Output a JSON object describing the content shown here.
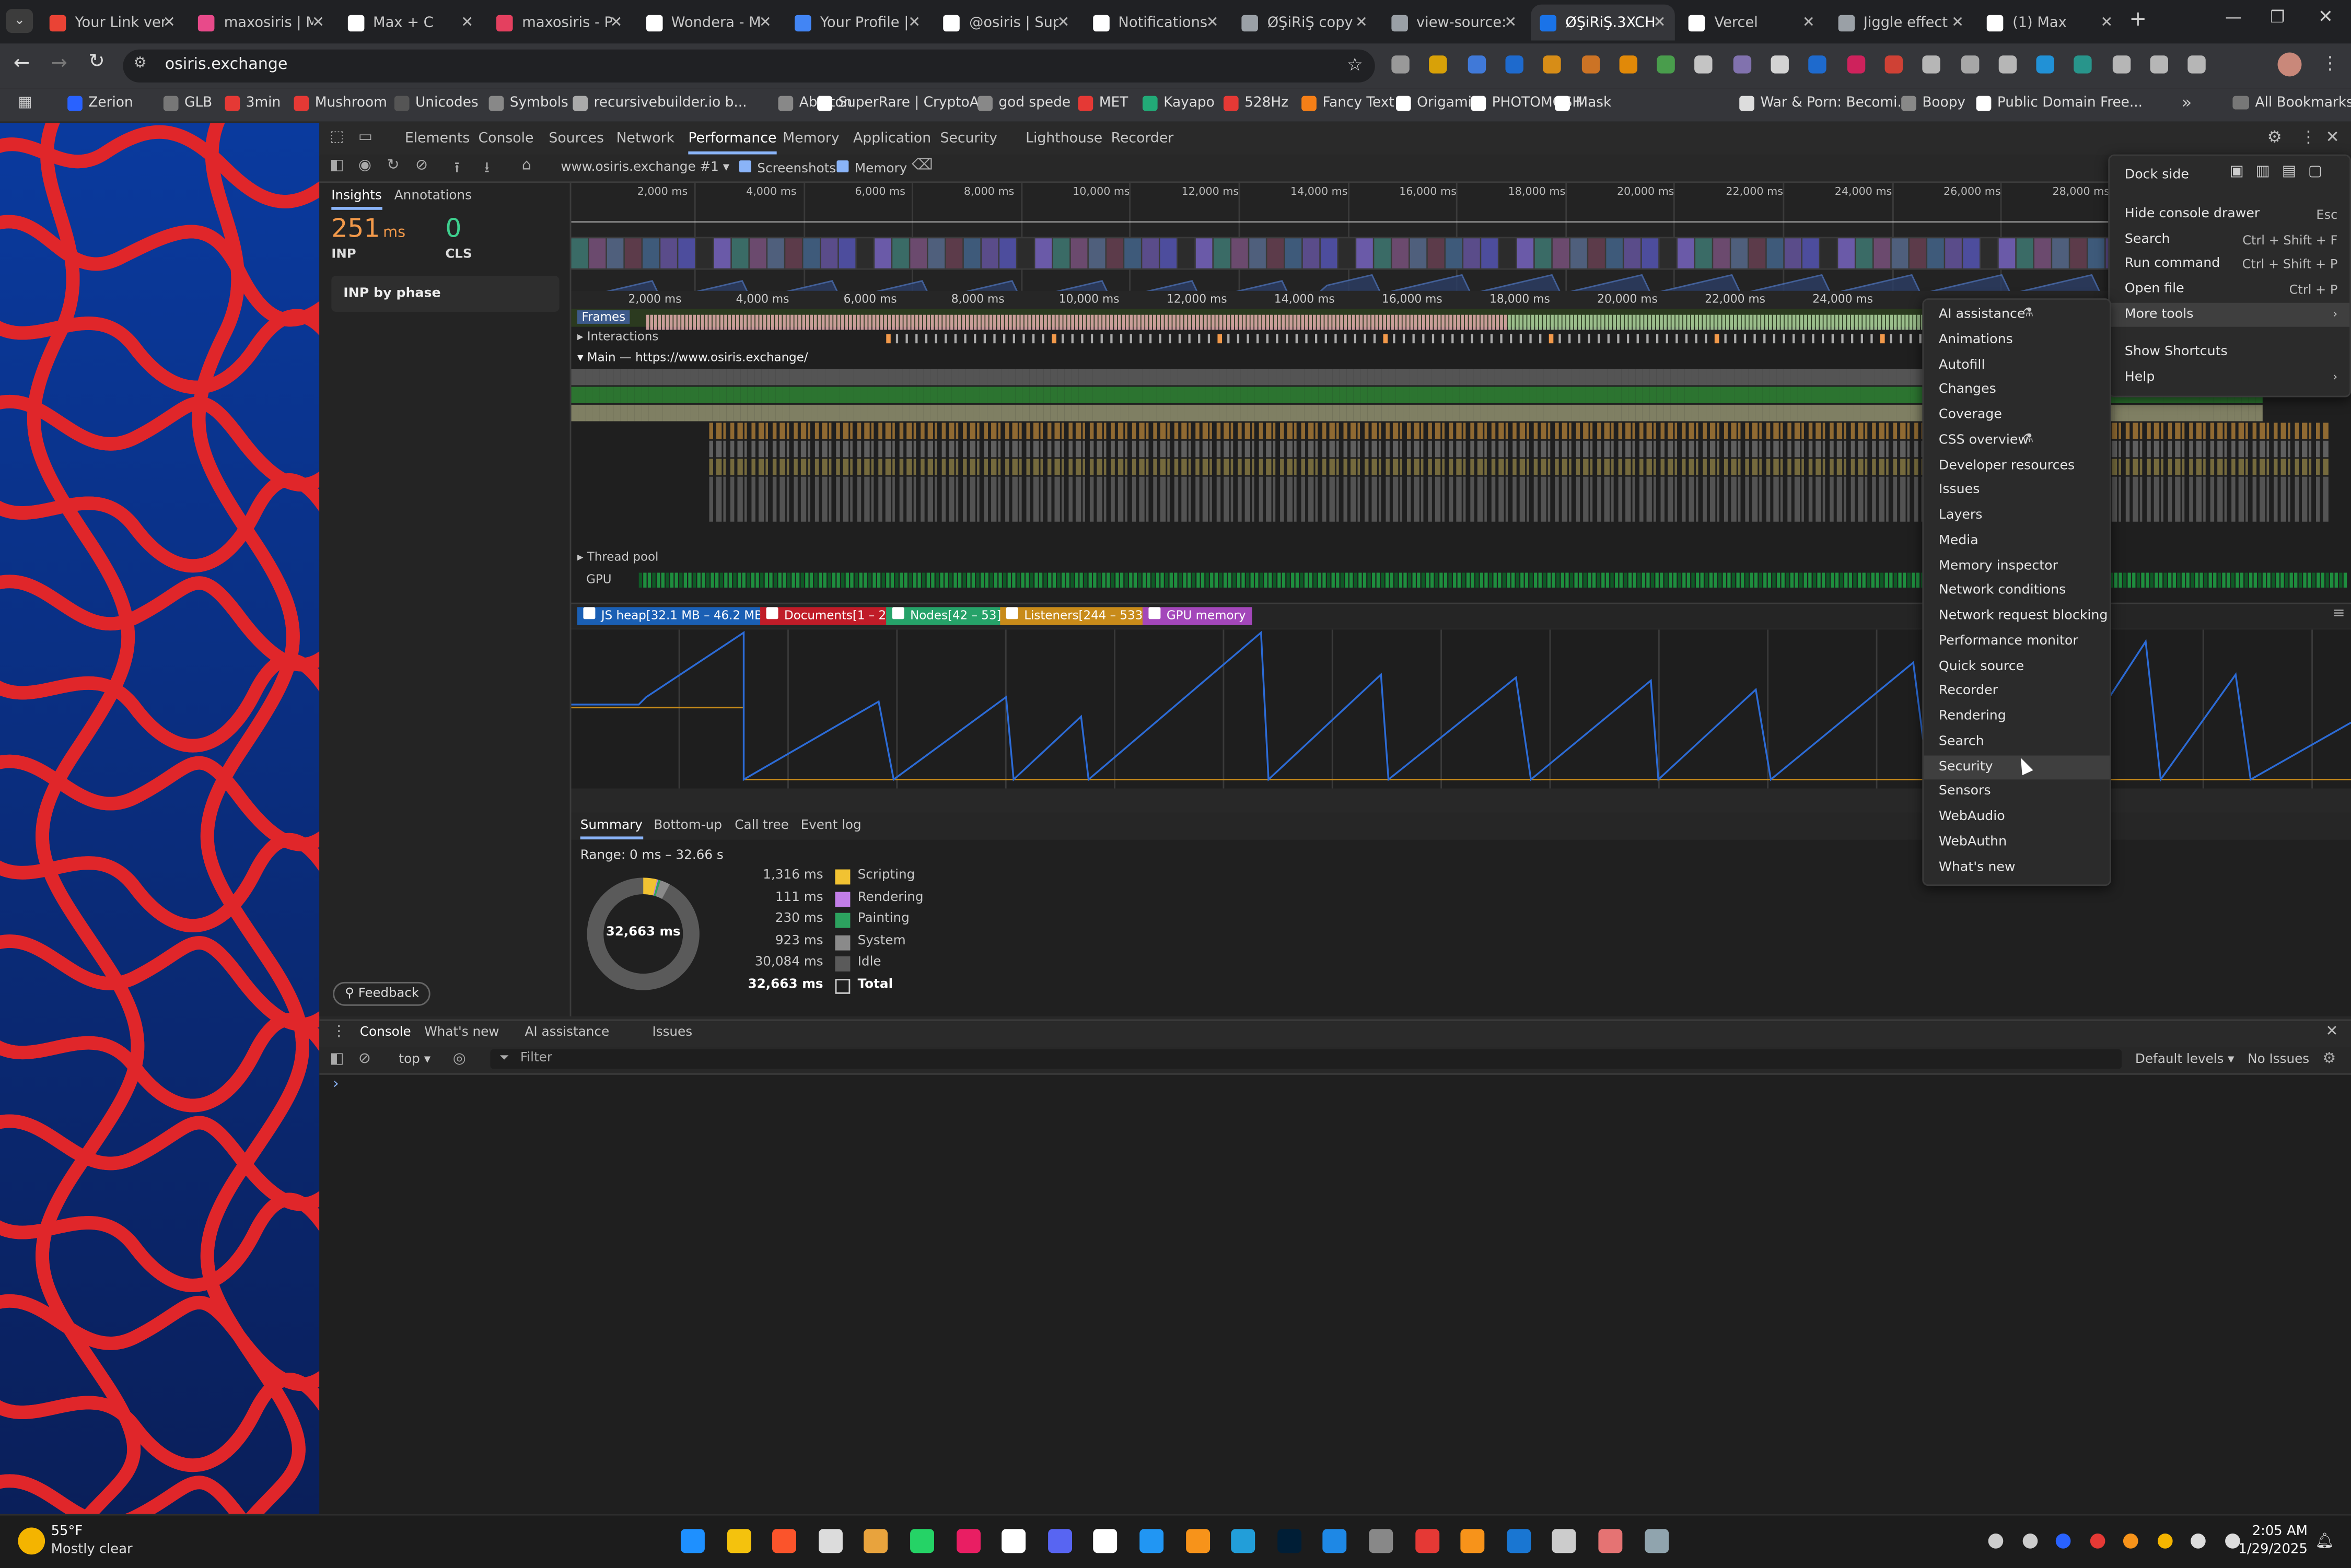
{
  "browser": {
    "tabs": [
      {
        "label": "Your Link ver",
        "color": "#ea4335"
      },
      {
        "label": "maxosiris | M",
        "color": "#e84a8a"
      },
      {
        "label": "Max + C",
        "color": "#ffffff"
      },
      {
        "label": "maxosiris - P",
        "color": "#e4405f"
      },
      {
        "label": "Wondera - M",
        "color": "#ffffff"
      },
      {
        "label": "Your Profile |",
        "color": "#4285f4"
      },
      {
        "label": "@osiris | Sup",
        "color": "#ffffff"
      },
      {
        "label": "Notifications",
        "color": "#ffffff"
      },
      {
        "label": "ØŞiRiŞ copy",
        "color": "#9aa0a6"
      },
      {
        "label": "view-source:",
        "color": "#9aa0a6"
      },
      {
        "label": "ØŞiRiŞ.3XCH",
        "color": "#1a73e8"
      },
      {
        "label": "Vercel",
        "color": "#ffffff"
      },
      {
        "label": "Jiggle effect",
        "color": "#9aa0a6"
      },
      {
        "label": "(1) Max",
        "color": "#ffffff"
      }
    ],
    "active_tab_index": 10,
    "url": "osiris.exchange",
    "bookmarks": [
      "Zerion",
      "GLB",
      "3min",
      "Mushroom",
      "Unicodes",
      "Symbols",
      "recursivebuilder.io b...",
      "Ableton",
      "SuperRare | CryptoA...",
      "god spede",
      "MET",
      "Kayapo",
      "528Hz",
      "Fancy Text",
      "Origami",
      "PHOTOMOSH",
      "Mask",
      "War & Porn: Becomi...",
      "Boopy",
      "Public Domain Free..."
    ],
    "all_bookmarks": "All Bookmarks"
  },
  "devtools": {
    "tabs": [
      "Elements",
      "Console",
      "Sources",
      "Network",
      "Performance",
      "Memory",
      "Application",
      "Security",
      "Lighthouse",
      "Recorder"
    ],
    "active_tab": "Performance",
    "recording_select": "www.osiris.exchange #1",
    "screenshots_label": "Screenshots",
    "memory_label": "Memory",
    "sidebar": {
      "tabs": [
        "Insights",
        "Annotations"
      ],
      "inp_value": "251",
      "inp_unit": "ms",
      "inp_label": "INP",
      "cls_value": "0",
      "cls_label": "CLS",
      "inp_by_phase": "INP by phase",
      "feedback": "Feedback"
    },
    "ruler_top": [
      "2,000 ms",
      "4,000 ms",
      "6,000 ms",
      "8,000 ms",
      "10,000 ms",
      "12,000 ms",
      "14,000 ms",
      "16,000 ms",
      "18,000 ms",
      "20,000 ms",
      "22,000 ms",
      "24,000 ms",
      "26,000 ms",
      "28,000 ms"
    ],
    "ruler_main": [
      "2,000 ms",
      "4,000 ms",
      "6,000 ms",
      "8,000 ms",
      "10,000 ms",
      "12,000 ms",
      "14,000 ms",
      "16,000 ms",
      "18,000 ms",
      "20,000 ms",
      "22,000 ms",
      "24,000 ms"
    ],
    "tracks": {
      "frames": "Frames",
      "interactions": "Interactions",
      "main": "Main — https://www.osiris.exchange/",
      "thread_pool": "Thread pool",
      "gpu": "GPU"
    },
    "memory_counters": [
      {
        "label": "JS heap[32.1 MB – 46.2 MB]",
        "color": "#1a5fb4"
      },
      {
        "label": "Documents[1 – 2]",
        "color": "#c01c28"
      },
      {
        "label": "Nodes[42 – 53]",
        "color": "#26a269"
      },
      {
        "label": "Listeners[244 – 533]",
        "color": "#c88b1a"
      },
      {
        "label": "GPU memory",
        "color": "#a347ba"
      }
    ],
    "bottom_tabs": [
      "Summary",
      "Bottom-up",
      "Call tree",
      "Event log"
    ],
    "range": "Range: 0 ms – 32.66 s",
    "donut_total": "32,663 ms",
    "summary": [
      {
        "value": "1,316 ms",
        "label": "Scripting",
        "color": "#f1c232",
        "fraction": 0.04
      },
      {
        "value": "111 ms",
        "label": "Rendering",
        "color": "#c27ee8",
        "fraction": 0.003
      },
      {
        "value": "230 ms",
        "label": "Painting",
        "color": "#2ca25f",
        "fraction": 0.007
      },
      {
        "value": "923 ms",
        "label": "System",
        "color": "#8a8a8a",
        "fraction": 0.028
      },
      {
        "value": "30,084 ms",
        "label": "Idle",
        "color": "#5a5a5a",
        "fraction": 0.921
      },
      {
        "value": "32,663 ms",
        "label": "Total",
        "color": "#1f1f1f",
        "fraction": 1
      }
    ],
    "drawer_tabs": [
      "Console",
      "What's new",
      "AI assistance",
      "Issues"
    ],
    "console_context": "top",
    "console_filter_placeholder": "Filter",
    "default_levels": "Default levels",
    "no_issues": "No Issues",
    "main_menu": {
      "dock_side": "Dock side",
      "items": [
        {
          "label": "Hide console drawer",
          "shortcut": "Esc"
        },
        {
          "label": "Search",
          "shortcut": "Ctrl + Shift + F"
        },
        {
          "label": "Run command",
          "shortcut": "Ctrl + Shift + P"
        },
        {
          "label": "Open file",
          "shortcut": "Ctrl + P"
        },
        {
          "label": "More tools",
          "shortcut": ""
        },
        {
          "label": "Show Shortcuts",
          "shortcut": ""
        },
        {
          "label": "Help",
          "shortcut": ""
        }
      ]
    },
    "more_tools": [
      "AI assistance",
      "Animations",
      "Autofill",
      "Changes",
      "Coverage",
      "CSS overview",
      "Developer resources",
      "Issues",
      "Layers",
      "Media",
      "Memory inspector",
      "Network conditions",
      "Network request blocking",
      "Performance monitor",
      "Quick source",
      "Recorder",
      "Rendering",
      "Search",
      "Security",
      "Sensors",
      "WebAudio",
      "WebAuthn",
      "What's new"
    ],
    "more_tools_hovered": "Security"
  },
  "taskbar": {
    "weather_temp": "55°F",
    "weather_desc": "Mostly clear",
    "time": "2:05 AM",
    "date": "1/29/2025"
  }
}
